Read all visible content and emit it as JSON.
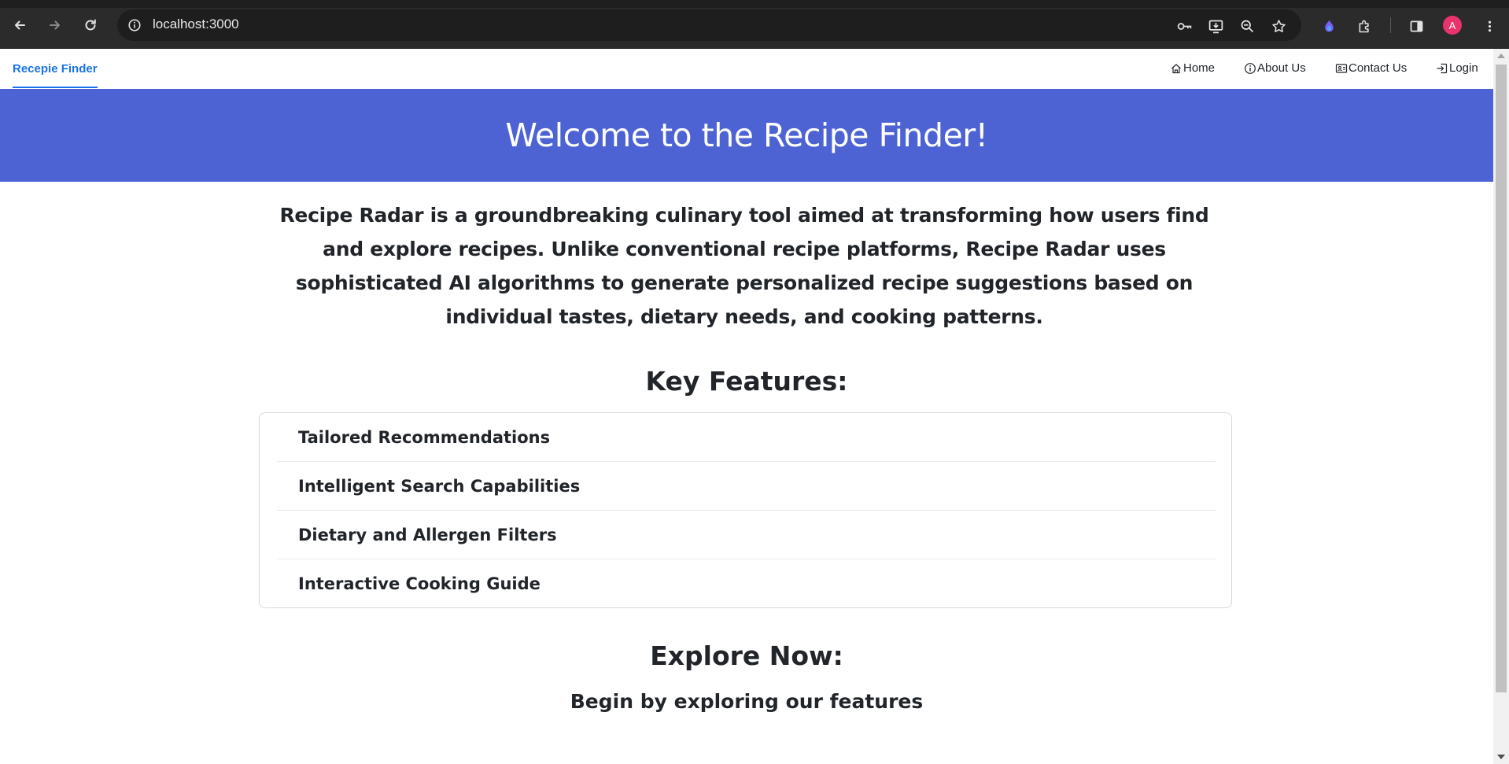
{
  "browser": {
    "url": "localhost:3000",
    "profile_initial": "A",
    "profile_color": "#e8336d",
    "toolbar_icons": [
      "back-icon",
      "forward-icon",
      "reload-icon",
      "site-info-icon",
      "password-key-icon",
      "install-app-icon",
      "zoom-icon",
      "bookmark-star-icon",
      "ai-assistant-icon",
      "extensions-icon",
      "side-panel-icon",
      "menu-dots-icon"
    ]
  },
  "navbar": {
    "brand": "Recepie Finder",
    "brand_color": "#1a73e8",
    "links": [
      {
        "label": "Home",
        "icon": "home-icon"
      },
      {
        "label": "About Us",
        "icon": "info-icon"
      },
      {
        "label": "Contact Us",
        "icon": "contact-card-icon"
      },
      {
        "label": "Login",
        "icon": "login-icon"
      }
    ]
  },
  "hero": {
    "title": "Welcome to the Recipe Finder!",
    "background": "#4d63d4"
  },
  "intro": {
    "text": "Recipe Radar is a groundbreaking culinary tool aimed at transforming how users find and explore recipes. Unlike conventional recipe platforms, Recipe Radar uses sophisticated AI algorithms to generate personalized recipe suggestions based on individual tastes, dietary needs, and cooking patterns."
  },
  "features": {
    "title": "Key Features:",
    "items": [
      "Tailored Recommendations",
      "Intelligent Search Capabilities",
      "Dietary and Allergen Filters",
      "Interactive Cooking Guide"
    ]
  },
  "explore": {
    "title": "Explore Now:",
    "subtitle": "Begin by exploring our features"
  }
}
